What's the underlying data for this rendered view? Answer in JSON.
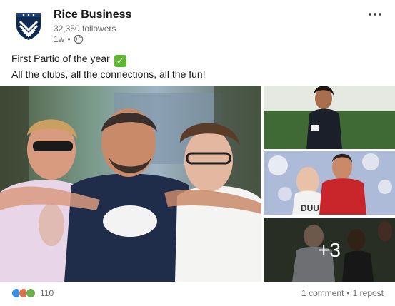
{
  "post": {
    "author": "Rice Business",
    "followers": "32,350 followers",
    "time": "1w",
    "separator": "•",
    "text_line1": "First Partio of the year",
    "text_line2": "All the clubs, all the connections, all the fun!",
    "check_emoji": "✓"
  },
  "gallery": {
    "more_count": "+3"
  },
  "social": {
    "reaction_count": "110",
    "comments": "1 comment",
    "separator": "•",
    "reposts": "1 repost"
  },
  "icons": {
    "logo": "rice-owl-shield-icon",
    "visibility": "globe-icon",
    "menu": "more-horizontal-icon"
  },
  "colors": {
    "logo_shield": "#0f2b52",
    "check_green": "#5fb832",
    "like_blue": "#378fe9",
    "love_orange": "#df704d",
    "support_green": "#6dae4f"
  }
}
